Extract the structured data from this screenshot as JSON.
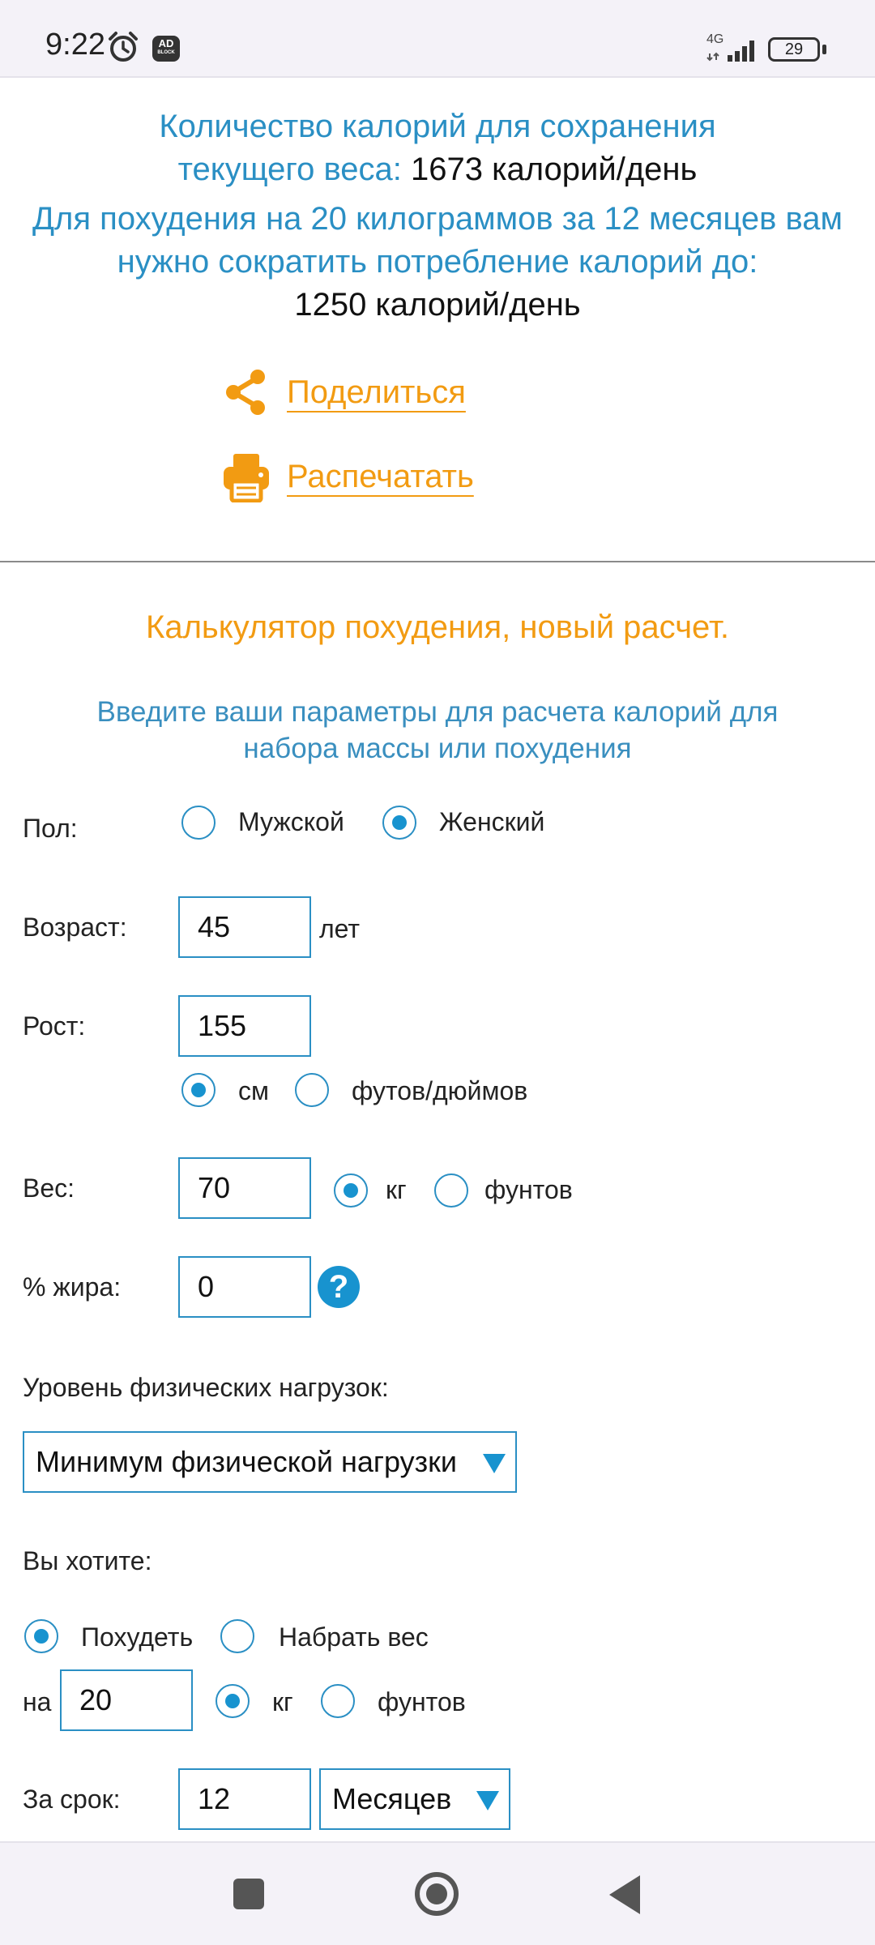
{
  "status_bar": {
    "time": "9:22",
    "network": "4G",
    "battery": "29",
    "icons": [
      "alarm-icon",
      "adblock-icon",
      "signal-icon",
      "battery-icon"
    ],
    "adblock_label_1": "AD",
    "adblock_label_2": "BLOCK"
  },
  "results": {
    "maintain_label": "Количество калорий для сохранения текущего веса:",
    "maintain_value": "1673 калорий/день",
    "loss_label": "Для похудения на 20 килограммов за 12 месяцев вам нужно сократить потребление калорий до:",
    "loss_value": "1250 калорий/день",
    "share_label": "Поделиться",
    "print_label": "Распечатать"
  },
  "calculator": {
    "title": "Калькулятор похудения, новый расчет.",
    "subtitle": "Введите ваши параметры для расчета калорий для набора массы или похудения",
    "gender_label": "Пол:",
    "gender_male": "Мужской",
    "gender_female": "Женский",
    "gender_selected": "female",
    "age_label": "Возраст:",
    "age_value": "45",
    "age_unit": "лет",
    "height_label": "Рост:",
    "height_value": "155",
    "height_unit_cm": "см",
    "height_unit_ft": "футов/дюймов",
    "height_unit_selected": "cm",
    "weight_label": "Вес:",
    "weight_value": "70",
    "weight_unit_kg": "кг",
    "weight_unit_lb": "фунтов",
    "weight_unit_selected": "kg",
    "fat_label": "% жира:",
    "fat_value": "0",
    "help_glyph": "?",
    "activity_label": "Уровень физических нагрузок:",
    "activity_value": "Минимум физической нагрузки",
    "goal_label": "Вы хотите:",
    "goal_lose": "Похудеть",
    "goal_gain": "Набрать вес",
    "goal_selected": "lose",
    "amount_label": "на",
    "amount_value": "20",
    "amount_unit_kg": "кг",
    "amount_unit_lb": "фунтов",
    "amount_unit_selected": "kg",
    "period_label": "За срок:",
    "period_value": "12",
    "period_unit": "Месяцев"
  },
  "colors": {
    "accent_blue": "#2a8fc4",
    "accent_orange": "#f29b12",
    "radio_fill": "#1893cf"
  }
}
